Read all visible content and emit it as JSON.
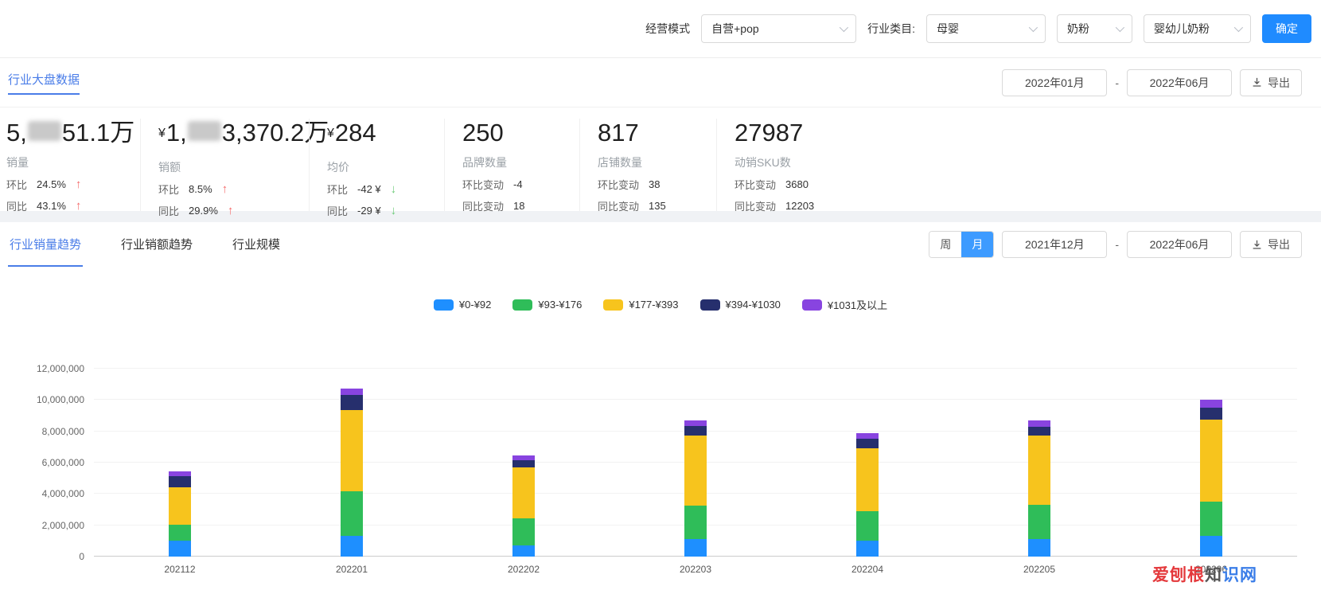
{
  "colors": {
    "accent": "#1f8bff",
    "link": "#4a7de8",
    "toggle_active": "#3d9bff",
    "up_arrow": "#f56c6c",
    "down_arrow": "#6bcb77"
  },
  "filters": {
    "mode_label": "经营模式",
    "mode_value": "自营+pop",
    "category_label": "行业类目:",
    "category_values": [
      "母婴",
      "奶粉",
      "婴幼儿奶粉"
    ],
    "confirm_label": "确定"
  },
  "overview": {
    "title": "行业大盘数据",
    "date_start": "2022年01月",
    "date_sep": "-",
    "date_end": "2022年06月",
    "export_label": "导出",
    "cards": [
      {
        "currency": "",
        "value_prefix": "5,",
        "masked": true,
        "value_suffix": "51.1万",
        "label": "销量",
        "metrics": [
          {
            "key": "环比",
            "value": "24.5%",
            "dir": "up"
          },
          {
            "key": "同比",
            "value": "43.1%",
            "dir": "up"
          }
        ]
      },
      {
        "currency": "¥",
        "value_prefix": "1,",
        "masked": true,
        "value_suffix": "3,370.2万",
        "label": "销额",
        "metrics": [
          {
            "key": "环比",
            "value": "8.5%",
            "dir": "up"
          },
          {
            "key": "同比",
            "value": "29.9%",
            "dir": "up"
          }
        ]
      },
      {
        "currency": "¥",
        "value_prefix": "284",
        "masked": false,
        "value_suffix": "",
        "label": "均价",
        "metrics": [
          {
            "key": "环比",
            "value": "-42 ¥",
            "dir": "down"
          },
          {
            "key": "同比",
            "value": "-29 ¥",
            "dir": "down"
          }
        ]
      },
      {
        "currency": "",
        "value_prefix": "250",
        "masked": false,
        "value_suffix": "",
        "label": "品牌数量",
        "metrics": [
          {
            "key": "环比变动",
            "value": "-4"
          },
          {
            "key": "同比变动",
            "value": "18"
          }
        ]
      },
      {
        "currency": "",
        "value_prefix": "817",
        "masked": false,
        "value_suffix": "",
        "label": "店铺数量",
        "metrics": [
          {
            "key": "环比变动",
            "value": "38"
          },
          {
            "key": "同比变动",
            "value": "135"
          }
        ]
      },
      {
        "currency": "",
        "value_prefix": "27987",
        "masked": false,
        "value_suffix": "",
        "label": "动销SKU数",
        "metrics": [
          {
            "key": "环比变动",
            "value": "3680"
          },
          {
            "key": "同比变动",
            "value": "12203"
          }
        ]
      }
    ]
  },
  "trend": {
    "tabs": [
      {
        "label": "行业销量趋势",
        "active": true
      },
      {
        "label": "行业销额趋势",
        "active": false
      },
      {
        "label": "行业规模",
        "active": false
      }
    ],
    "period_toggle": [
      {
        "label": "周",
        "active": false
      },
      {
        "label": "月",
        "active": true
      }
    ],
    "date_start": "2021年12月",
    "date_sep": "-",
    "date_end": "2022年06月",
    "export_label": "导出"
  },
  "chart_data": {
    "type": "bar",
    "stacked": true,
    "categories": [
      "202112",
      "202201",
      "202202",
      "202203",
      "202204",
      "202205",
      "202206"
    ],
    "series": [
      {
        "name": "¥0-¥92",
        "color": "#1e8fff",
        "values": [
          1000000,
          1300000,
          700000,
          1100000,
          1000000,
          1100000,
          1300000
        ]
      },
      {
        "name": "¥93-¥176",
        "color": "#2fbd59",
        "values": [
          1050000,
          2850000,
          1750000,
          2150000,
          1900000,
          2200000,
          2200000
        ]
      },
      {
        "name": "¥177-¥393",
        "color": "#f7c41d",
        "values": [
          2400000,
          5200000,
          3250000,
          4500000,
          4000000,
          4450000,
          5250000
        ]
      },
      {
        "name": "¥394-¥1030",
        "color": "#262f6d",
        "values": [
          700000,
          950000,
          450000,
          600000,
          650000,
          550000,
          750000
        ]
      },
      {
        "name": "¥1031及以上",
        "color": "#8844e0",
        "values": [
          300000,
          450000,
          300000,
          350000,
          350000,
          400000,
          500000
        ]
      }
    ],
    "title": "",
    "xlabel": "",
    "ylabel": "",
    "ylim": [
      0,
      12000000
    ],
    "ytick_interval": 2000000,
    "yticks": [
      "0",
      "2,000,000",
      "4,000,000",
      "6,000,000",
      "8,000,000",
      "10,000,000",
      "12,000,000"
    ],
    "grid": true,
    "legend_position": "top-center"
  },
  "watermark": {
    "text": "爱刨根知识网",
    "chars": [
      {
        "ch": "爱",
        "color": "#e4393c"
      },
      {
        "ch": "刨",
        "color": "#e4393c"
      },
      {
        "ch": "根",
        "color": "#e4393c"
      },
      {
        "ch": "知",
        "color": "#555555"
      },
      {
        "ch": "识",
        "color": "#3a7de8"
      },
      {
        "ch": "网",
        "color": "#3a7de8"
      }
    ]
  }
}
